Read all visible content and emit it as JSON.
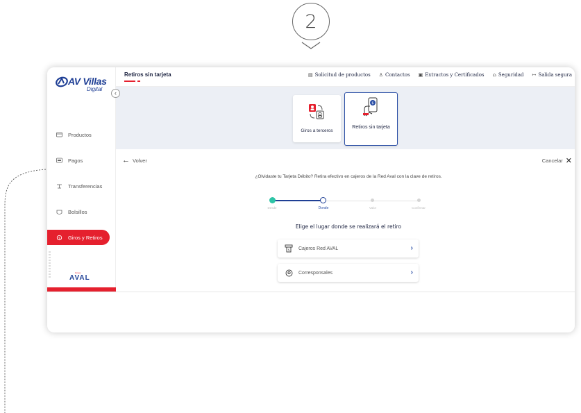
{
  "step": {
    "number": "2"
  },
  "brand": {
    "name": "AV Villas",
    "sub": "Digital",
    "group_logo": "AVAL",
    "group_prefix": "Grupo"
  },
  "sidebar": {
    "items": [
      {
        "label": "Productos",
        "icon": "wallet-icon"
      },
      {
        "label": "Pagos",
        "icon": "card-icon"
      },
      {
        "label": "Transferencias",
        "icon": "transfer-icon"
      },
      {
        "label": "Bolsillos",
        "icon": "pocket-icon"
      },
      {
        "label": "Giros y Retiros",
        "icon": "money-transfer-icon",
        "active": true
      }
    ]
  },
  "header": {
    "title": "Retiros sin tarjeta",
    "links": [
      {
        "label": "Solicitud de productos",
        "icon": "form-icon"
      },
      {
        "label": "Contactos",
        "icon": "user-icon"
      },
      {
        "label": "Extractos y Certificados",
        "icon": "document-icon"
      },
      {
        "label": "Seguridad",
        "icon": "lock-icon"
      },
      {
        "label": "Salida segura",
        "icon": "logout-icon"
      }
    ]
  },
  "products": [
    {
      "label": "Giros a terceros",
      "selected": false
    },
    {
      "label": "Retiros sin tarjeta",
      "selected": true
    }
  ],
  "content": {
    "back_label": "Volver",
    "cancel_label": "Cancelar",
    "intro": "¿Olvidaste tu Tarjeta Débito? Retira efectivo en cajeros de la Red Aval con la clave de retiros.",
    "steps": [
      {
        "label": "Desde",
        "state": "done"
      },
      {
        "label": "Donde",
        "state": "current"
      },
      {
        "label": "Valor",
        "state": "pending"
      },
      {
        "label": "Confirmar",
        "state": "pending"
      }
    ],
    "choose_title": "Elige el lugar donde se realizará el retiro",
    "options": [
      {
        "label": "Cajeros Red AVAL",
        "icon": "atm-icon"
      },
      {
        "label": "Corresponsales",
        "icon": "location-pin-icon"
      }
    ]
  },
  "colors": {
    "brand_red": "#e5202e",
    "brand_blue": "#1f3f95",
    "accent_blue": "#2b4fa6",
    "step_done": "#2ec4a6",
    "band_bg": "#eceff5"
  }
}
